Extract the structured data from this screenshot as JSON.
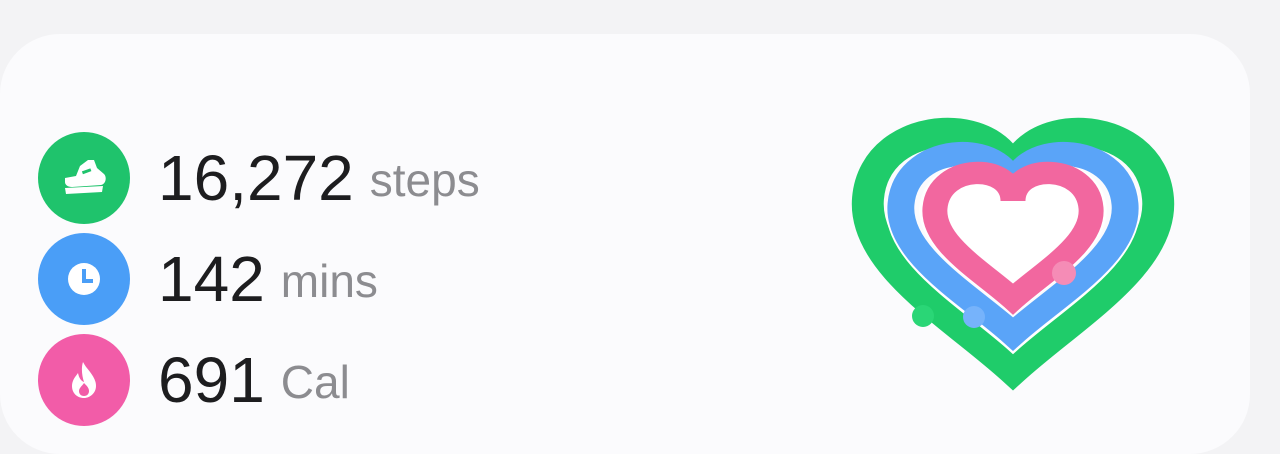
{
  "activity": {
    "steps": {
      "value": "16,272",
      "unit": "steps",
      "icon": "shoe-icon",
      "color": "#1fc36c"
    },
    "mins": {
      "value": "142",
      "unit": "mins",
      "icon": "clock-icon",
      "color": "#4a9ef7"
    },
    "cal": {
      "value": "691",
      "unit": "Cal",
      "icon": "flame-icon",
      "color": "#f25ca8"
    }
  },
  "rings": {
    "outer_color": "#1fcc6a",
    "middle_color": "#5aa4f8",
    "inner_color": "#f2679f"
  }
}
